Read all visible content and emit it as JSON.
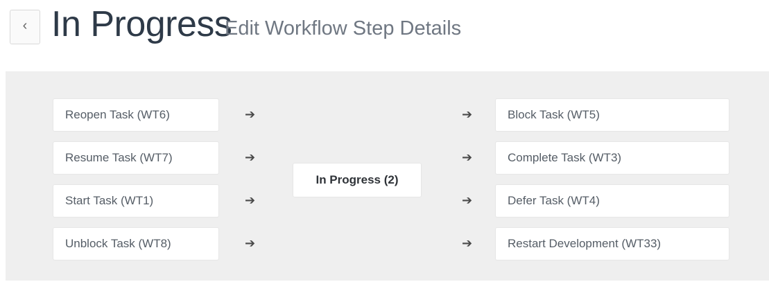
{
  "header": {
    "back_icon": "‹",
    "title": "In Progress",
    "subtitle": "Edit Workflow Step Details"
  },
  "workflow": {
    "arrow_glyph": "➔",
    "center_state": "In Progress (2)",
    "incoming": [
      {
        "label": "Reopen Task (WT6)"
      },
      {
        "label": "Resume Task (WT7)"
      },
      {
        "label": "Start Task (WT1)"
      },
      {
        "label": "Unblock Task (WT8)"
      }
    ],
    "outgoing": [
      {
        "label": "Block Task (WT5)"
      },
      {
        "label": "Complete Task (WT3)"
      },
      {
        "label": "Defer Task (WT4)"
      },
      {
        "label": "Restart Development (WT33)"
      }
    ]
  },
  "colors": {
    "panel_background": "#efefef",
    "title": "#2e3a48",
    "subtitle": "#6f7782"
  }
}
